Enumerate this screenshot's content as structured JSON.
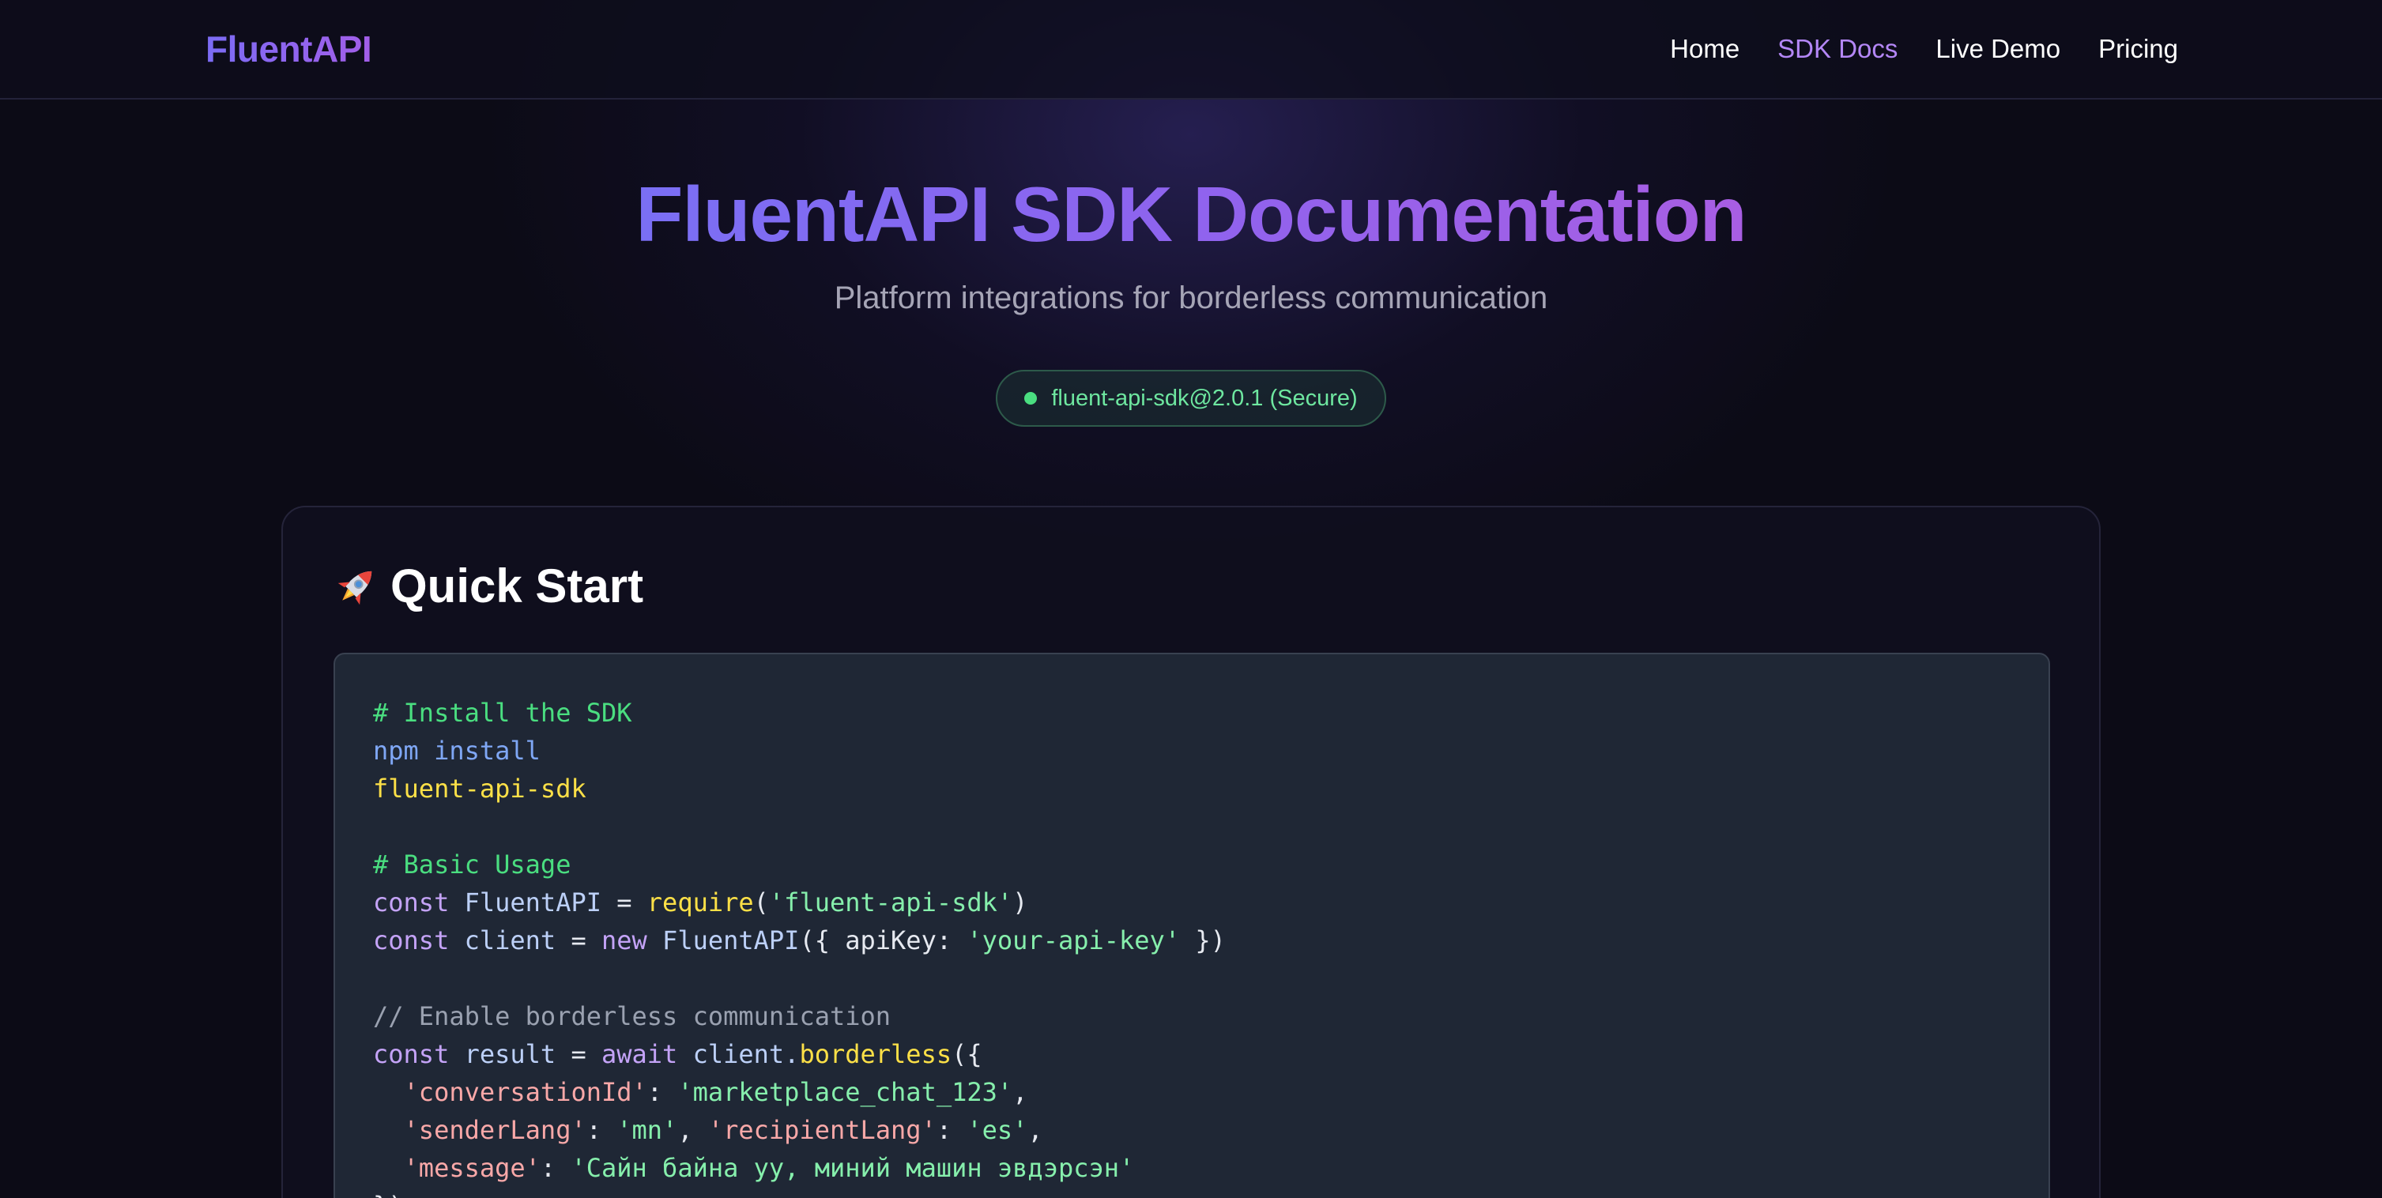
{
  "nav": {
    "brand": "FluentAPI",
    "links": [
      {
        "label": "Home",
        "active": false
      },
      {
        "label": "SDK Docs",
        "active": true
      },
      {
        "label": "Live Demo",
        "active": false
      },
      {
        "label": "Pricing",
        "active": false
      }
    ]
  },
  "hero": {
    "title": "FluentAPI SDK Documentation",
    "subtitle": "Platform integrations for borderless communication",
    "badge": "fluent-api-sdk@2.0.1 (Secure)"
  },
  "quick_start": {
    "icon": "rocket-icon",
    "title": "Quick Start",
    "code": {
      "l1": "# Install the SDK",
      "l2": "npm install",
      "l3": "fluent-api-sdk",
      "l5": "# Basic Usage",
      "l6a": "const",
      "l6b": " FluentAPI",
      "l6c": " = ",
      "l6d": "require",
      "l6e": "(",
      "l6f": "'fluent-api-sdk'",
      "l6g": ")",
      "l7a": "const",
      "l7b": " client",
      "l7c": " = ",
      "l7d": "new",
      "l7e": " FluentAPI",
      "l7f": "({ apiKey: ",
      "l7g": "'your-api-key'",
      "l7h": " })",
      "l9": "// Enable borderless communication",
      "l10a": "const",
      "l10b": " result",
      "l10c": " = ",
      "l10d": "await",
      "l10e": " client.",
      "l10f": "borderless",
      "l10g": "({",
      "l11a": "  'conversationId'",
      "l11b": ": ",
      "l11c": "'marketplace_chat_123'",
      "l11d": ",",
      "l12a": "  'senderLang'",
      "l12b": ": ",
      "l12c": "'mn'",
      "l12d": ", ",
      "l12e": "'recipientLang'",
      "l12f": ": ",
      "l12g": "'es'",
      "l12h": ",",
      "l13a": "  'message'",
      "l13b": ": ",
      "l13c": "'Сайн байна уу, миний машин эвдэрсэн'",
      "l14": "})"
    }
  },
  "colors": {
    "accent": "#8b5cf6",
    "nav_active": "#b487f7",
    "badge_green": "#4ade80",
    "background": "#0c0b16",
    "code_bg": "#1f2735"
  }
}
